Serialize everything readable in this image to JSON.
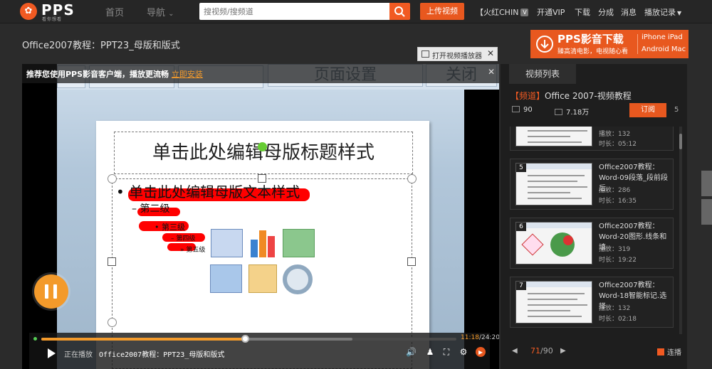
{
  "header": {
    "logo_text": "PPS",
    "logo_sub": "看你想看",
    "nav_home": "首页",
    "nav_guide": "导航",
    "search_placeholder": "搜视频/搜频道",
    "upload_label": "上传视频",
    "user_name": "【火红CHIN",
    "user_badge": "V",
    "vip_label": "开通VIP",
    "download_label": "下载",
    "share_label": "分成",
    "messages_label": "消息",
    "history_label": "播放记录"
  },
  "page_title": "Office2007教程：PPT23_母版和版式",
  "open_player_label": "打开视频播放器",
  "ad": {
    "title": "PPS影音下载",
    "subtitle": "臻高清电影，电视随心看",
    "platform1": "iPhone iPad",
    "platform2": "Android Mac"
  },
  "player": {
    "notice_text": "推荐您使用PPS影音客户端，播放更流畅",
    "notice_link": "立即安装",
    "ribbon_btn1": "页面设置",
    "ribbon_btn2": "关闭",
    "slide_title": "单击此处编辑母版标题样式",
    "bullet1": "• 单击此处编辑母版文本样式",
    "bullet2": "– 第二级",
    "bullet3": "• 第三级",
    "bullet4": "– 第四级",
    "bullet5": "» 第五级",
    "progress": 0.49,
    "buffered": 0.75,
    "current_time": "11:18",
    "total_time": "24:20",
    "status_text": "正在播放",
    "video_name": "Office2007教程：PPT23_母版和版式"
  },
  "sidebar": {
    "tab_label": "视频列表",
    "channel_tag": "【频道】",
    "channel_name": "Office 2007-视频教程",
    "video_count": "90",
    "play_count": "7.18万",
    "subscribe_label": "订阅",
    "subscriber_count": "5",
    "items": [
      {
        "num": "",
        "title": "",
        "plays": "播放：132",
        "duration": "时长：05:12"
      },
      {
        "num": "5",
        "title": "Office2007教程：Word-09段落_段前段后.",
        "plays": "播放：286",
        "duration": "时长：16:35"
      },
      {
        "num": "6",
        "title": "Office2007教程：Word-20图形.线条和填",
        "plays": "播放：319",
        "duration": "时长：19:22"
      },
      {
        "num": "7",
        "title": "Office2007教程：Word-18智能标记.选择",
        "plays": "播放：132",
        "duration": "时长：02:18"
      }
    ],
    "page_current": "71",
    "page_total": "/90",
    "continuous_label": "连播"
  }
}
